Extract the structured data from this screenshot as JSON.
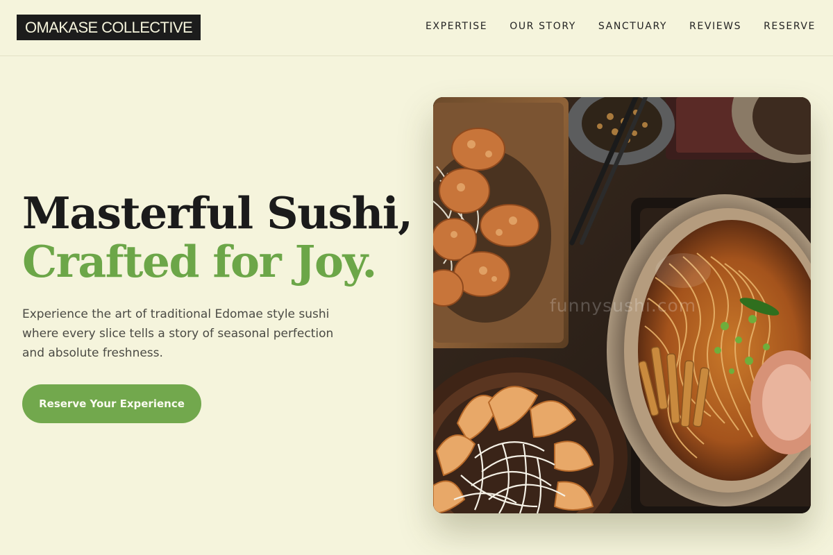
{
  "header": {
    "logo": "OMAKASE COLLECTIVE",
    "nav": [
      {
        "label": "EXPERTISE"
      },
      {
        "label": "OUR STORY"
      },
      {
        "label": "SANCTUARY"
      },
      {
        "label": "REVIEWS"
      },
      {
        "label": "RESERVE"
      }
    ]
  },
  "hero": {
    "title_line1": "Masterful Sushi,",
    "title_line2": "Crafted for Joy.",
    "description": "Experience the art of traditional Edomae style sushi where every slice tells a story of seasonal perfection and absolute freshness.",
    "cta_label": "Reserve Your Experience"
  },
  "image": {
    "watermark": "funnysushi.com",
    "subject": "overhead view of fried chicken, gyoza, and ramen on dark wood table"
  },
  "colors": {
    "background": "#f5f4dc",
    "accent_green": "#6ca648",
    "button_green": "#72a84d",
    "text_dark": "#1b1b1b",
    "logo_bg": "#1c1c1c"
  }
}
